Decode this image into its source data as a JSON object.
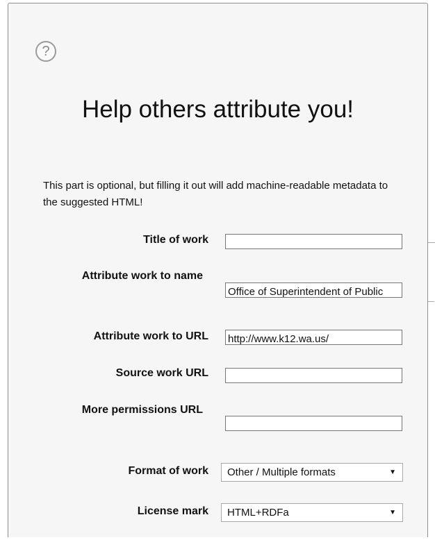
{
  "help_title": "?",
  "heading": "Help others attribute you!",
  "intro": "This part is optional, but filling it out will add machine-readable metadata to the suggested HTML!",
  "fields": {
    "title": {
      "label": "Title of work",
      "value": ""
    },
    "attr_name": {
      "label": "Attribute work to name",
      "value": "Office of Superintendent of Public Instruction"
    },
    "attr_url": {
      "label": "Attribute work to URL",
      "value": "http://www.k12.wa.us/"
    },
    "source_url": {
      "label": "Source work URL",
      "value": ""
    },
    "permissions_url": {
      "label": "More permissions URL",
      "value": ""
    },
    "format": {
      "label": "Format of work",
      "value": "Other / Multiple formats"
    },
    "license_mark": {
      "label": "License mark",
      "value": "HTML+RDFa"
    }
  },
  "icons": {
    "help": "help-question-icon",
    "dropdown": "triangle-down-icon"
  }
}
